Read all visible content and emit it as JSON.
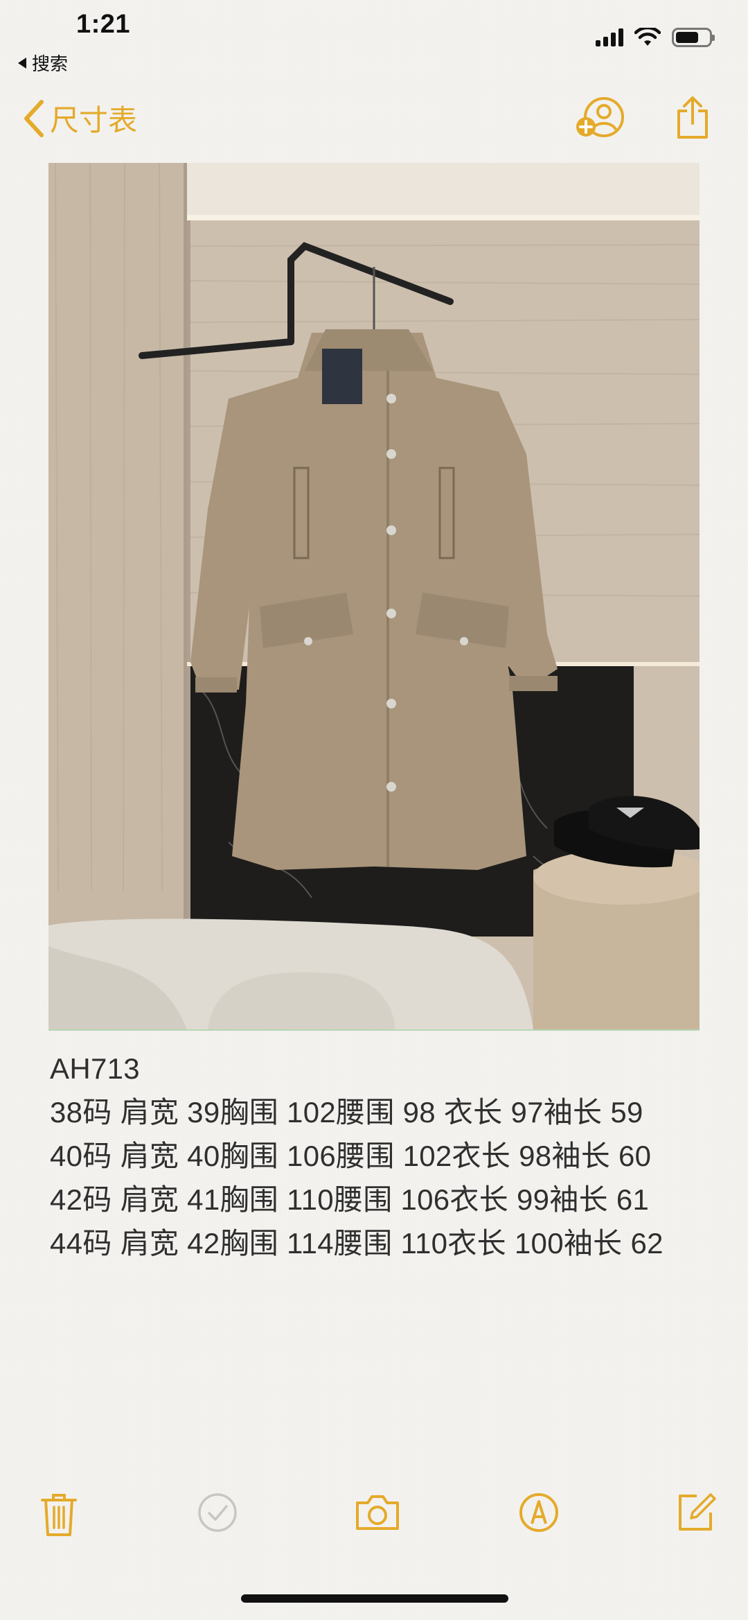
{
  "status_bar": {
    "time": "1:21",
    "back_app": "搜索",
    "battery_level": 0.7
  },
  "nav": {
    "back_label": "尺寸表",
    "accent_color": "#e4aa2a"
  },
  "note": {
    "lines": [
      "AH713",
      "38码 肩宽 39胸围 102腰围 98 衣长 97袖长 59",
      "40码 肩宽 40胸围 106腰围 102衣长 98袖长 60",
      "42码 肩宽 41胸围 110腰围 106衣长 99袖长 61",
      "44码 肩宽 42胸围 114腰围 110衣长 100袖长 62"
    ]
  },
  "toolbar": {
    "icons": [
      "trash-icon",
      "checklist-icon",
      "camera-icon",
      "markup-icon",
      "compose-icon"
    ]
  }
}
